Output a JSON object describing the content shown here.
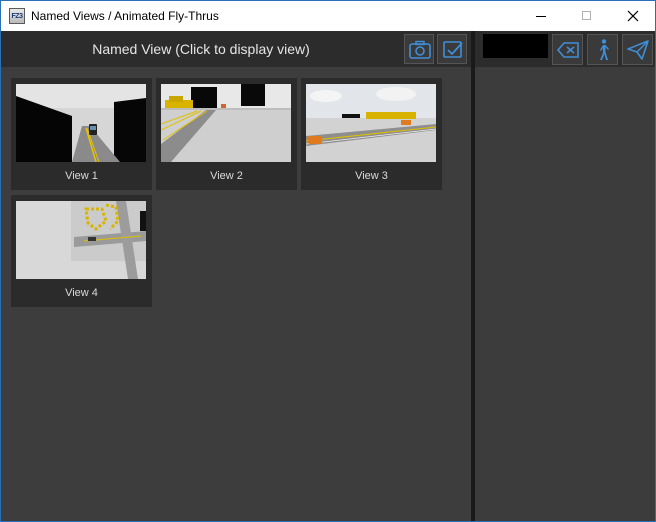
{
  "window": {
    "title": "Named Views / Animated Fly-Thrus",
    "app_icon_text": "FZ3"
  },
  "named_views": {
    "header": "Named View (Click to display view)",
    "toolbar": {
      "camera_icon": "camera-icon",
      "check_icon": "checkbox-icon"
    },
    "views": [
      {
        "label": "View 1"
      },
      {
        "label": "View 2"
      },
      {
        "label": "View 3"
      },
      {
        "label": "View 4"
      }
    ]
  },
  "flythru": {
    "name_value": "",
    "toolbar": {
      "delete_icon": "backspace-delete-icon",
      "walk_icon": "walking-person-icon",
      "send_icon": "paper-plane-icon"
    }
  },
  "colors": {
    "accent": "#3f7fc0",
    "panel": "#3d3d3d",
    "header": "#2c2c2c"
  }
}
